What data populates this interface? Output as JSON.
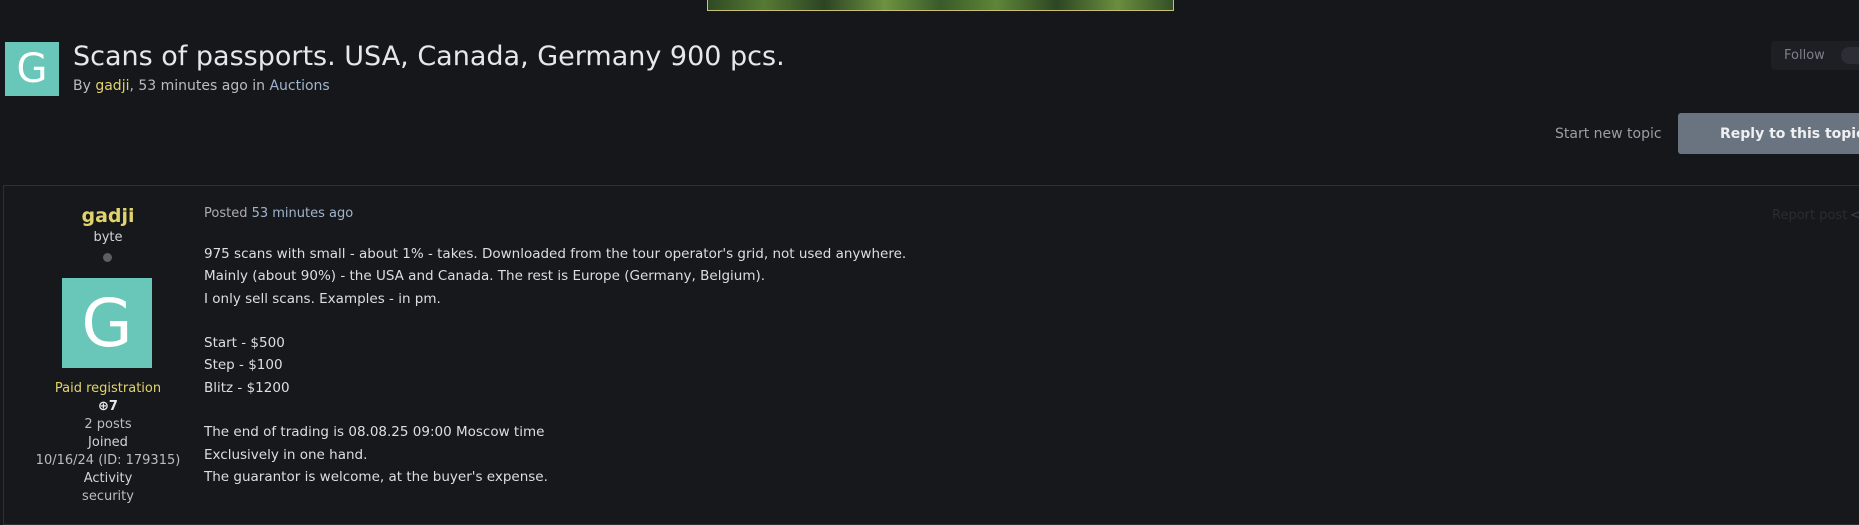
{
  "topic": {
    "avatar_letter": "G",
    "title": "Scans of passports. USA, Canada, Germany 900 pcs.",
    "meta_by": "By ",
    "author": "gadji",
    "meta_time": ", 53 minutes ago in ",
    "forum": "Auctions"
  },
  "actions": {
    "follow_label": "Follow",
    "start_topic_label": "Start new topic",
    "reply_label": "Reply to this topic"
  },
  "post": {
    "author": {
      "name": "gadji",
      "rank": "byte",
      "avatar_letter": "G",
      "group": "Paid registration",
      "reputation": "7",
      "posts": "2 posts",
      "joined_label": "Joined",
      "joined_value": "10/16/24 (ID: 179315)",
      "activity_label": "Activity",
      "activity_value": "security"
    },
    "posted_prefix": "Posted ",
    "posted_time": "53 minutes ago",
    "report_label": "Report post",
    "body": {
      "line1": "975 scans with small - about 1% - takes. Downloaded from the tour operator's grid, not used anywhere.",
      "line2": "Mainly (about 90%) - the USA and Canada. The rest is Europe (Germany, Belgium).",
      "line3": "I only sell scans. Examples - in pm.",
      "line4": "Start - $500",
      "line5": "Step - $100",
      "line6": "Blitz - $1200",
      "line7": "The end of trading is 08.08.25 09:00 Moscow time",
      "line8": "Exclusively in one hand.",
      "line9": "The guarantor is welcome, at the buyer's expense."
    }
  },
  "colors": {
    "background": "#16171b",
    "accent_author": "#e1d36b",
    "avatar": "#68c7b8",
    "reply_button": "#6a7480"
  }
}
